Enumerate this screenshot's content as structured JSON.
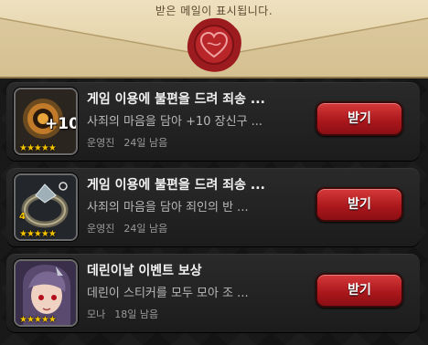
{
  "header": {
    "notice": "받은 메일이 표시됩니다."
  },
  "mails": [
    {
      "title": "게임 이용에 불편을 드려 죄송 ...",
      "description": "사죄의 마음을 담아 +10 장신구 ...",
      "sender": "운영진",
      "remaining": "24일 남음",
      "button": "받기",
      "stars": "★★★★★",
      "badge": "+10"
    },
    {
      "title": "게임 이용에 불편을 드려 죄송 ...",
      "description": "사죄의 마음을 담아 죄인의 반 ...",
      "sender": "운영진",
      "remaining": "24일 남음",
      "button": "받기",
      "stars": "★★★★★",
      "badge": "4"
    },
    {
      "title": "데린이날 이벤트 보상",
      "description": "데린이 스티커를 모두 모아 조 ...",
      "sender": "모나",
      "remaining": "18일 남음",
      "button": "받기",
      "stars": "★★★★★"
    }
  ],
  "colors": {
    "accent": "#b31d22",
    "star": "#f5c400",
    "envelope": "#e6d4ab"
  }
}
